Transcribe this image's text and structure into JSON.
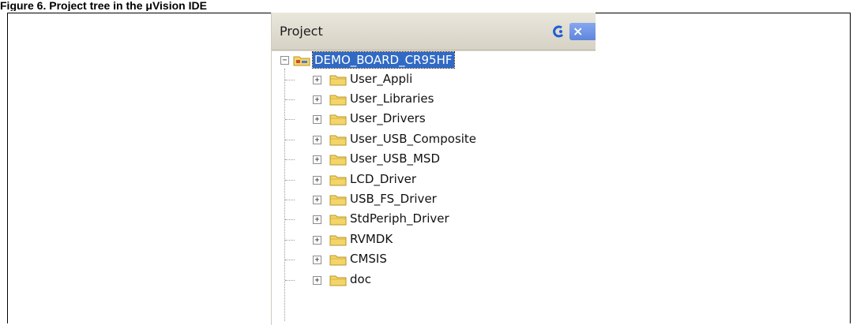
{
  "figure": {
    "caption": "Figure 6. Project tree in the μVision IDE"
  },
  "panel": {
    "title": "Project",
    "close_glyph": "×",
    "pin_icon": "pin-icon",
    "root": {
      "label": "DEMO_BOARD_CR95HF",
      "expand_glyph": "−"
    },
    "items": [
      {
        "label": "User_Appli",
        "expand_glyph": "+"
      },
      {
        "label": "User_Libraries",
        "expand_glyph": "+"
      },
      {
        "label": "User_Drivers",
        "expand_glyph": "+"
      },
      {
        "label": "User_USB_Composite",
        "expand_glyph": "+"
      },
      {
        "label": "User_USB_MSD",
        "expand_glyph": "+"
      },
      {
        "label": "LCD_Driver",
        "expand_glyph": "+"
      },
      {
        "label": "USB_FS_Driver",
        "expand_glyph": "+"
      },
      {
        "label": "StdPeriph_Driver",
        "expand_glyph": "+"
      },
      {
        "label": "RVMDK",
        "expand_glyph": "+"
      },
      {
        "label": "CMSIS",
        "expand_glyph": "+"
      },
      {
        "label": "doc",
        "expand_glyph": "+"
      }
    ]
  },
  "colors": {
    "selection": "#316ac5",
    "folder": "#f3d568",
    "folder_edge": "#b8962a"
  }
}
